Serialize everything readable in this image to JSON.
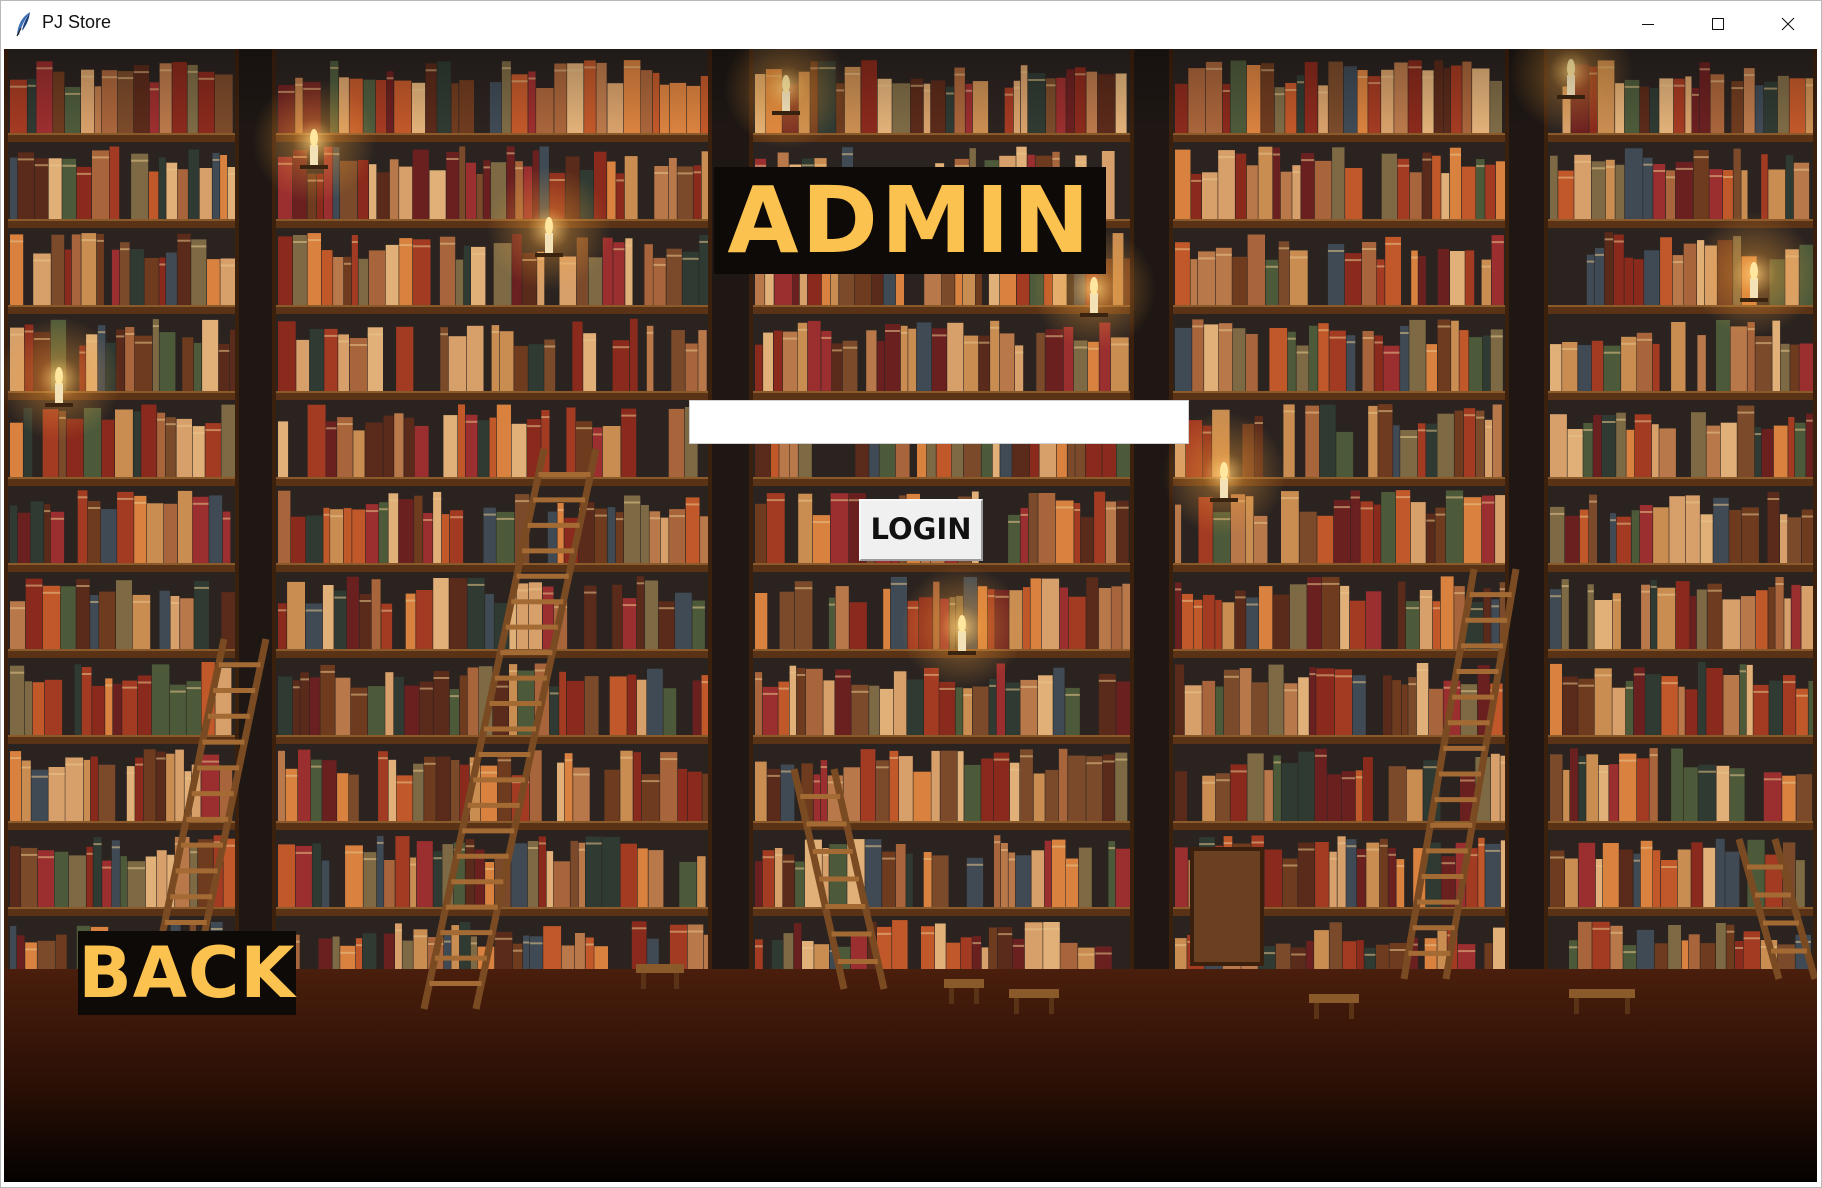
{
  "window": {
    "title": "PJ Store",
    "app_icon": "feather-icon",
    "controls": {
      "minimize_icon": "minimize-icon",
      "maximize_icon": "maximize-icon",
      "close_icon": "close-icon"
    }
  },
  "screen": {
    "heading": "ADMIN",
    "password_field": {
      "value": "",
      "placeholder": ""
    },
    "login_label": "LOGIN",
    "back_label": "BACK",
    "background": "library-bookshelves-with-candles-and-ladders"
  },
  "colors": {
    "label_text": "#fcc24f",
    "label_background": "#0d0a08",
    "button_face": "#f0f0f0",
    "wood": "#5a3317"
  }
}
